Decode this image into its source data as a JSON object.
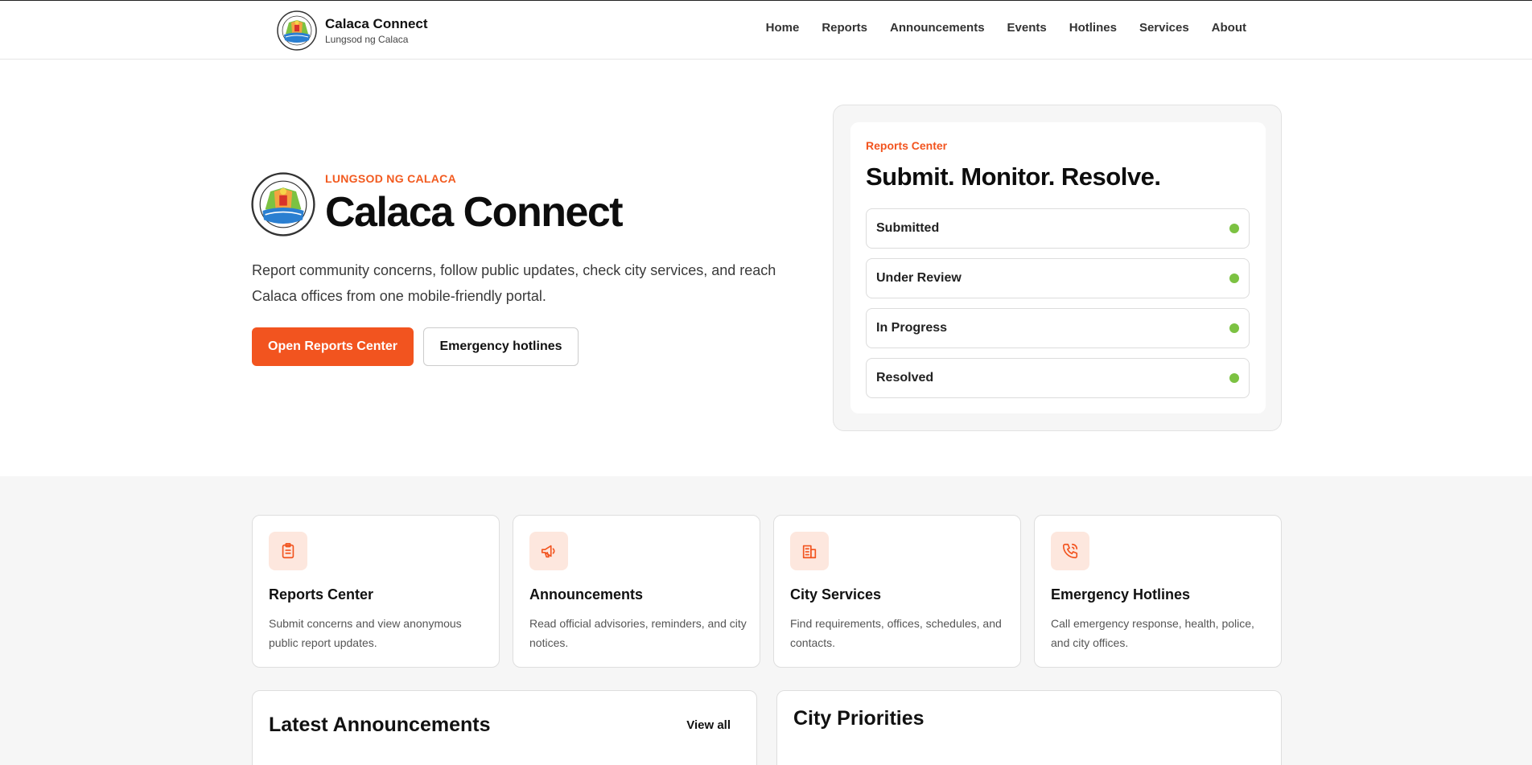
{
  "header": {
    "brand_title": "Calaca Connect",
    "brand_subtitle": "Lungsod ng Calaca",
    "nav": [
      "Home",
      "Reports",
      "Announcements",
      "Events",
      "Hotlines",
      "Services",
      "About"
    ]
  },
  "hero": {
    "kicker": "LUNGSOD NG CALACA",
    "title": "Calaca Connect",
    "description": "Report community concerns, follow public updates, check city services, and reach Calaca offices from one mobile-friendly portal.",
    "primary_button": "Open Reports Center",
    "secondary_button": "Emergency hotlines"
  },
  "reports_center": {
    "label": "Reports Center",
    "title": "Submit. Monitor. Resolve.",
    "statuses": [
      "Submitted",
      "Under Review",
      "In Progress",
      "Resolved"
    ],
    "status_color": "#7cc242"
  },
  "cards": [
    {
      "icon": "clipboard-icon",
      "title": "Reports Center",
      "desc": "Submit concerns and view anonymous public report updates."
    },
    {
      "icon": "megaphone-icon",
      "title": "Announcements",
      "desc": "Read official advisories, reminders, and city notices."
    },
    {
      "icon": "building-icon",
      "title": "City Services",
      "desc": "Find requirements, offices, schedules, and contacts."
    },
    {
      "icon": "phone-icon",
      "title": "Emergency Hotlines",
      "desc": "Call emergency response, health, police, and city offices."
    }
  ],
  "announcements": {
    "title": "Latest Announcements",
    "view_all": "View all"
  },
  "priorities": {
    "title": "City Priorities"
  },
  "colors": {
    "accent": "#f2541f",
    "icon_bg": "#fde7de",
    "section_bg": "#f6f6f6"
  }
}
